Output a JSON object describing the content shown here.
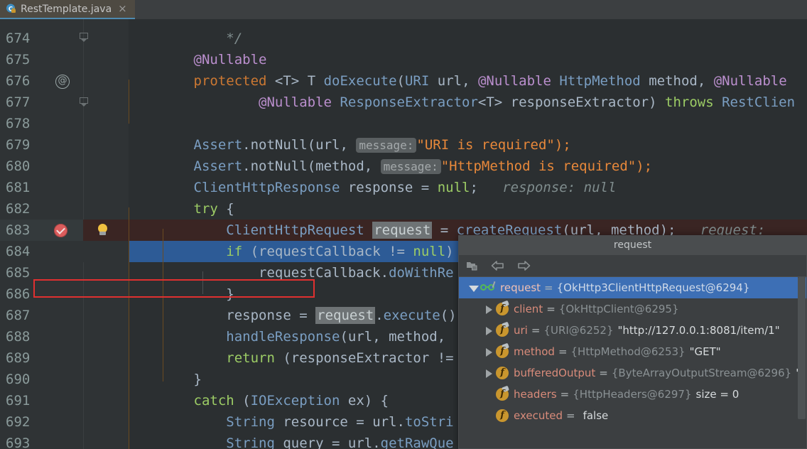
{
  "tab": {
    "label": "RestTemplate.java",
    "icon": "java-class-icon",
    "lock_badge": "lock-icon",
    "close_label": "×"
  },
  "editor": {
    "lines": [
      {
        "num": "674",
        "gutter": "fold-collapse",
        "state": "normal",
        "tokens": [
          {
            "t": "            ",
            "c": "plain"
          },
          {
            "t": "*/",
            "c": "hint-doc"
          }
        ]
      },
      {
        "num": "675",
        "gutter": "",
        "state": "normal",
        "tokens": [
          {
            "t": "        ",
            "c": "plain"
          },
          {
            "t": "@Nullable",
            "c": "ann"
          }
        ]
      },
      {
        "num": "676",
        "gutter": "annotation-marker",
        "state": "normal",
        "tokens": [
          {
            "t": "        ",
            "c": "plain"
          },
          {
            "t": "protected",
            "c": "kw"
          },
          {
            "t": " ",
            "c": "plain"
          },
          {
            "t": "<T>",
            "c": "plain"
          },
          {
            "t": " T ",
            "c": "plain"
          },
          {
            "t": "doExecute",
            "c": "meth"
          },
          {
            "t": "(",
            "c": "plain"
          },
          {
            "t": "URI",
            "c": "type"
          },
          {
            "t": " url, ",
            "c": "plain"
          },
          {
            "t": "@Nullable",
            "c": "ann"
          },
          {
            "t": " ",
            "c": "plain"
          },
          {
            "t": "HttpMethod",
            "c": "type"
          },
          {
            "t": " method, ",
            "c": "plain"
          },
          {
            "t": "@Nullable",
            "c": "ann"
          }
        ]
      },
      {
        "num": "677",
        "gutter": "fold-end",
        "state": "normal",
        "tokens": [
          {
            "t": "                ",
            "c": "plain"
          },
          {
            "t": "@Nullable",
            "c": "ann"
          },
          {
            "t": " ",
            "c": "plain"
          },
          {
            "t": "ResponseExtractor",
            "c": "type"
          },
          {
            "t": "<T> responseExtractor) ",
            "c": "plain"
          },
          {
            "t": "throws",
            "c": "kw2"
          },
          {
            "t": " ",
            "c": "plain"
          },
          {
            "t": "RestClien",
            "c": "type"
          }
        ]
      },
      {
        "num": "678",
        "gutter": "",
        "state": "normal",
        "tokens": []
      },
      {
        "num": "679",
        "gutter": "",
        "state": "normal",
        "tokens": [
          {
            "t": "        ",
            "c": "plain"
          },
          {
            "t": "Assert",
            "c": "type"
          },
          {
            "t": ".",
            "c": "plain"
          },
          {
            "t": "notNull",
            "c": "plain"
          },
          {
            "t": "(url, ",
            "c": "plain"
          },
          {
            "t": "message:",
            "c": "param-hint"
          },
          {
            "t": "\"URI is required\");",
            "c": "str"
          }
        ]
      },
      {
        "num": "680",
        "gutter": "",
        "state": "normal",
        "tokens": [
          {
            "t": "        ",
            "c": "plain"
          },
          {
            "t": "Assert",
            "c": "type"
          },
          {
            "t": ".",
            "c": "plain"
          },
          {
            "t": "notNull",
            "c": "plain"
          },
          {
            "t": "(method, ",
            "c": "plain"
          },
          {
            "t": "message:",
            "c": "param-hint"
          },
          {
            "t": "\"HttpMethod is required\");",
            "c": "str"
          }
        ]
      },
      {
        "num": "681",
        "gutter": "",
        "state": "normal",
        "tokens": [
          {
            "t": "        ",
            "c": "plain"
          },
          {
            "t": "ClientHttpResponse",
            "c": "type"
          },
          {
            "t": " response = ",
            "c": "plain"
          },
          {
            "t": "null",
            "c": "kw2"
          },
          {
            "t": ";",
            "c": "plain"
          },
          {
            "t": "   response: null",
            "c": "hint"
          }
        ]
      },
      {
        "num": "682",
        "gutter": "",
        "state": "normal",
        "tokens": [
          {
            "t": "        ",
            "c": "plain"
          },
          {
            "t": "try",
            "c": "kw2"
          },
          {
            "t": " {",
            "c": "plain"
          }
        ]
      },
      {
        "num": "683",
        "gutter": "breakpoint",
        "state": "breakpoint",
        "bulb": true,
        "tokens": [
          {
            "t": "            ",
            "c": "plain"
          },
          {
            "t": "ClientHttpRequest",
            "c": "type"
          },
          {
            "t": " ",
            "c": "plain"
          },
          {
            "t": "request",
            "c": "ident-hl"
          },
          {
            "t": " = ",
            "c": "plain"
          },
          {
            "t": "createRequest",
            "c": "meth"
          },
          {
            "t": "(url, method);",
            "c": "plain"
          },
          {
            "t": "   request:",
            "c": "hint"
          }
        ]
      },
      {
        "num": "684",
        "gutter": "",
        "state": "selected",
        "tokens": [
          {
            "t": "            ",
            "c": "plain"
          },
          {
            "t": "if",
            "c": "kw2"
          },
          {
            "t": " (requestCallback != ",
            "c": "plain"
          },
          {
            "t": "null",
            "c": "kw2"
          },
          {
            "t": ")",
            "c": "plain"
          }
        ]
      },
      {
        "num": "685",
        "gutter": "",
        "state": "normal",
        "tokens": [
          {
            "t": "                ",
            "c": "plain"
          },
          {
            "t": "requestCallback",
            "c": "plain"
          },
          {
            "t": ".",
            "c": "plain"
          },
          {
            "t": "doWithRe",
            "c": "meth"
          }
        ]
      },
      {
        "num": "686",
        "gutter": "",
        "state": "normal",
        "tokens": [
          {
            "t": "            ",
            "c": "plain"
          },
          {
            "t": "}",
            "c": "plain"
          }
        ]
      },
      {
        "num": "687",
        "gutter": "",
        "state": "normal",
        "tokens": [
          {
            "t": "            ",
            "c": "plain"
          },
          {
            "t": "response = ",
            "c": "plain"
          },
          {
            "t": "request",
            "c": "ident-hl"
          },
          {
            "t": ".",
            "c": "plain"
          },
          {
            "t": "execute",
            "c": "meth"
          },
          {
            "t": "()",
            "c": "plain"
          }
        ]
      },
      {
        "num": "688",
        "gutter": "",
        "state": "normal",
        "tokens": [
          {
            "t": "            ",
            "c": "plain"
          },
          {
            "t": "handleResponse",
            "c": "meth"
          },
          {
            "t": "(url, method,",
            "c": "plain"
          }
        ]
      },
      {
        "num": "689",
        "gutter": "",
        "state": "normal",
        "tokens": [
          {
            "t": "            ",
            "c": "plain"
          },
          {
            "t": "return",
            "c": "kw2"
          },
          {
            "t": " (responseExtractor !=",
            "c": "plain"
          }
        ]
      },
      {
        "num": "690",
        "gutter": "",
        "state": "normal",
        "tokens": [
          {
            "t": "        ",
            "c": "plain"
          },
          {
            "t": "}",
            "c": "plain"
          }
        ]
      },
      {
        "num": "691",
        "gutter": "",
        "state": "normal",
        "tokens": [
          {
            "t": "        ",
            "c": "plain"
          },
          {
            "t": "catch",
            "c": "kw2"
          },
          {
            "t": " (",
            "c": "plain"
          },
          {
            "t": "IOException",
            "c": "type"
          },
          {
            "t": " ex) {",
            "c": "plain"
          }
        ]
      },
      {
        "num": "692",
        "gutter": "",
        "state": "normal",
        "tokens": [
          {
            "t": "            ",
            "c": "plain"
          },
          {
            "t": "String",
            "c": "type"
          },
          {
            "t": " resource = url.",
            "c": "plain"
          },
          {
            "t": "toStri",
            "c": "meth"
          }
        ]
      },
      {
        "num": "693",
        "gutter": "",
        "state": "normal",
        "tokens": [
          {
            "t": "            ",
            "c": "plain"
          },
          {
            "t": "String",
            "c": "type"
          },
          {
            "t": " query = url.",
            "c": "plain"
          },
          {
            "t": "getRawQue",
            "c": "meth"
          }
        ]
      }
    ]
  },
  "popup": {
    "title": "request",
    "toolbar": [
      {
        "name": "copy-value-icon",
        "label": ""
      },
      {
        "name": "back-arrow-icon",
        "label": ""
      },
      {
        "name": "forward-arrow-icon",
        "label": ""
      }
    ],
    "tree": [
      {
        "indent": 0,
        "twist": "down",
        "icon": "watch-glasses-icon",
        "selected": true,
        "name": "request",
        "eq": "=",
        "ref": "{OkHttp3ClientHttpRequest@6294}",
        "value": ""
      },
      {
        "indent": 1,
        "twist": "right",
        "icon": "field-icon-shaded",
        "selected": false,
        "name": "client",
        "eq": "=",
        "ref": "{OkHttpClient@6295}",
        "value": ""
      },
      {
        "indent": 1,
        "twist": "right",
        "icon": "field-icon-shaded",
        "selected": false,
        "name": "uri",
        "eq": "=",
        "ref": "{URI@6252}",
        "value": "\"http://127.0.0.1:8081/item/1\""
      },
      {
        "indent": 1,
        "twist": "right",
        "icon": "field-icon-shaded",
        "selected": false,
        "name": "method",
        "eq": "=",
        "ref": "{HttpMethod@6253}",
        "value": "\"GET\""
      },
      {
        "indent": 1,
        "twist": "right",
        "icon": "field-icon",
        "selected": false,
        "name": "bufferedOutput",
        "eq": "=",
        "ref": "{ByteArrayOutputStream@6296}",
        "value": "\"\""
      },
      {
        "indent": 1,
        "twist": "none",
        "icon": "field-icon-shaded",
        "selected": false,
        "name": "headers",
        "eq": "=",
        "ref": "{HttpHeaders@6297}",
        "value": "size = 0"
      },
      {
        "indent": 1,
        "twist": "none",
        "icon": "field-icon",
        "selected": false,
        "name": "executed",
        "eq": "=",
        "ref": "",
        "value": "false"
      }
    ],
    "scrollbar": "vertical-scrollbar"
  },
  "colors": {
    "editor_bg": "#2b2f31",
    "gutter_bg": "#2f3335",
    "breakpoint_line_bg": "#3a2523",
    "selected_line_bg": "#2d5b96",
    "popup_bg": "#3c3f41",
    "popup_selected": "#3d6fb5",
    "accent_red_outline": "#e03030",
    "tab_underline": "#4e8ab0"
  }
}
